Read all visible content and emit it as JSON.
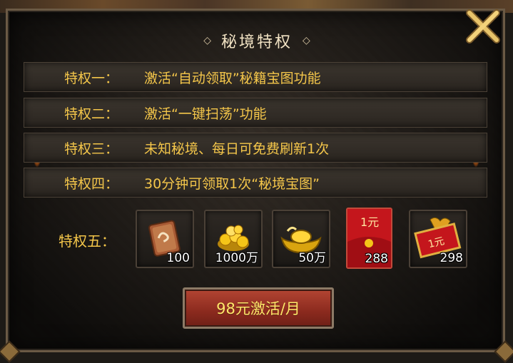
{
  "panel": {
    "title": "秘境特权",
    "title_deco": "◇",
    "privileges": [
      {
        "label": "特权一：",
        "text": "激活“自动领取”秘籍宝图功能"
      },
      {
        "label": "特权二：",
        "text": "激活“一键扫荡”功能"
      },
      {
        "label": "特权三：",
        "text": "未知秘境、每日可免费刷新1次"
      },
      {
        "label": "特权四：",
        "text": "30分钟可领取1次“秘境宝图”"
      }
    ],
    "privilege_five_label": "特权五：",
    "rewards": [
      {
        "icon": "scroll-icon",
        "qty": "100"
      },
      {
        "icon": "gold-coins-icon",
        "qty": "1000万"
      },
      {
        "icon": "gold-ingot-icon",
        "qty": "50万"
      },
      {
        "icon": "red-envelope-icon",
        "qty": "288",
        "envelope_text": "1元"
      },
      {
        "icon": "red-envelope-pack-icon",
        "qty": "298",
        "envelope_text": "1元"
      }
    ],
    "activate_button": "98元激活/月"
  },
  "colors": {
    "accent_gold": "#f4c64a",
    "button_red": "#8b2a1e",
    "title_cream": "#f2e3c4"
  }
}
